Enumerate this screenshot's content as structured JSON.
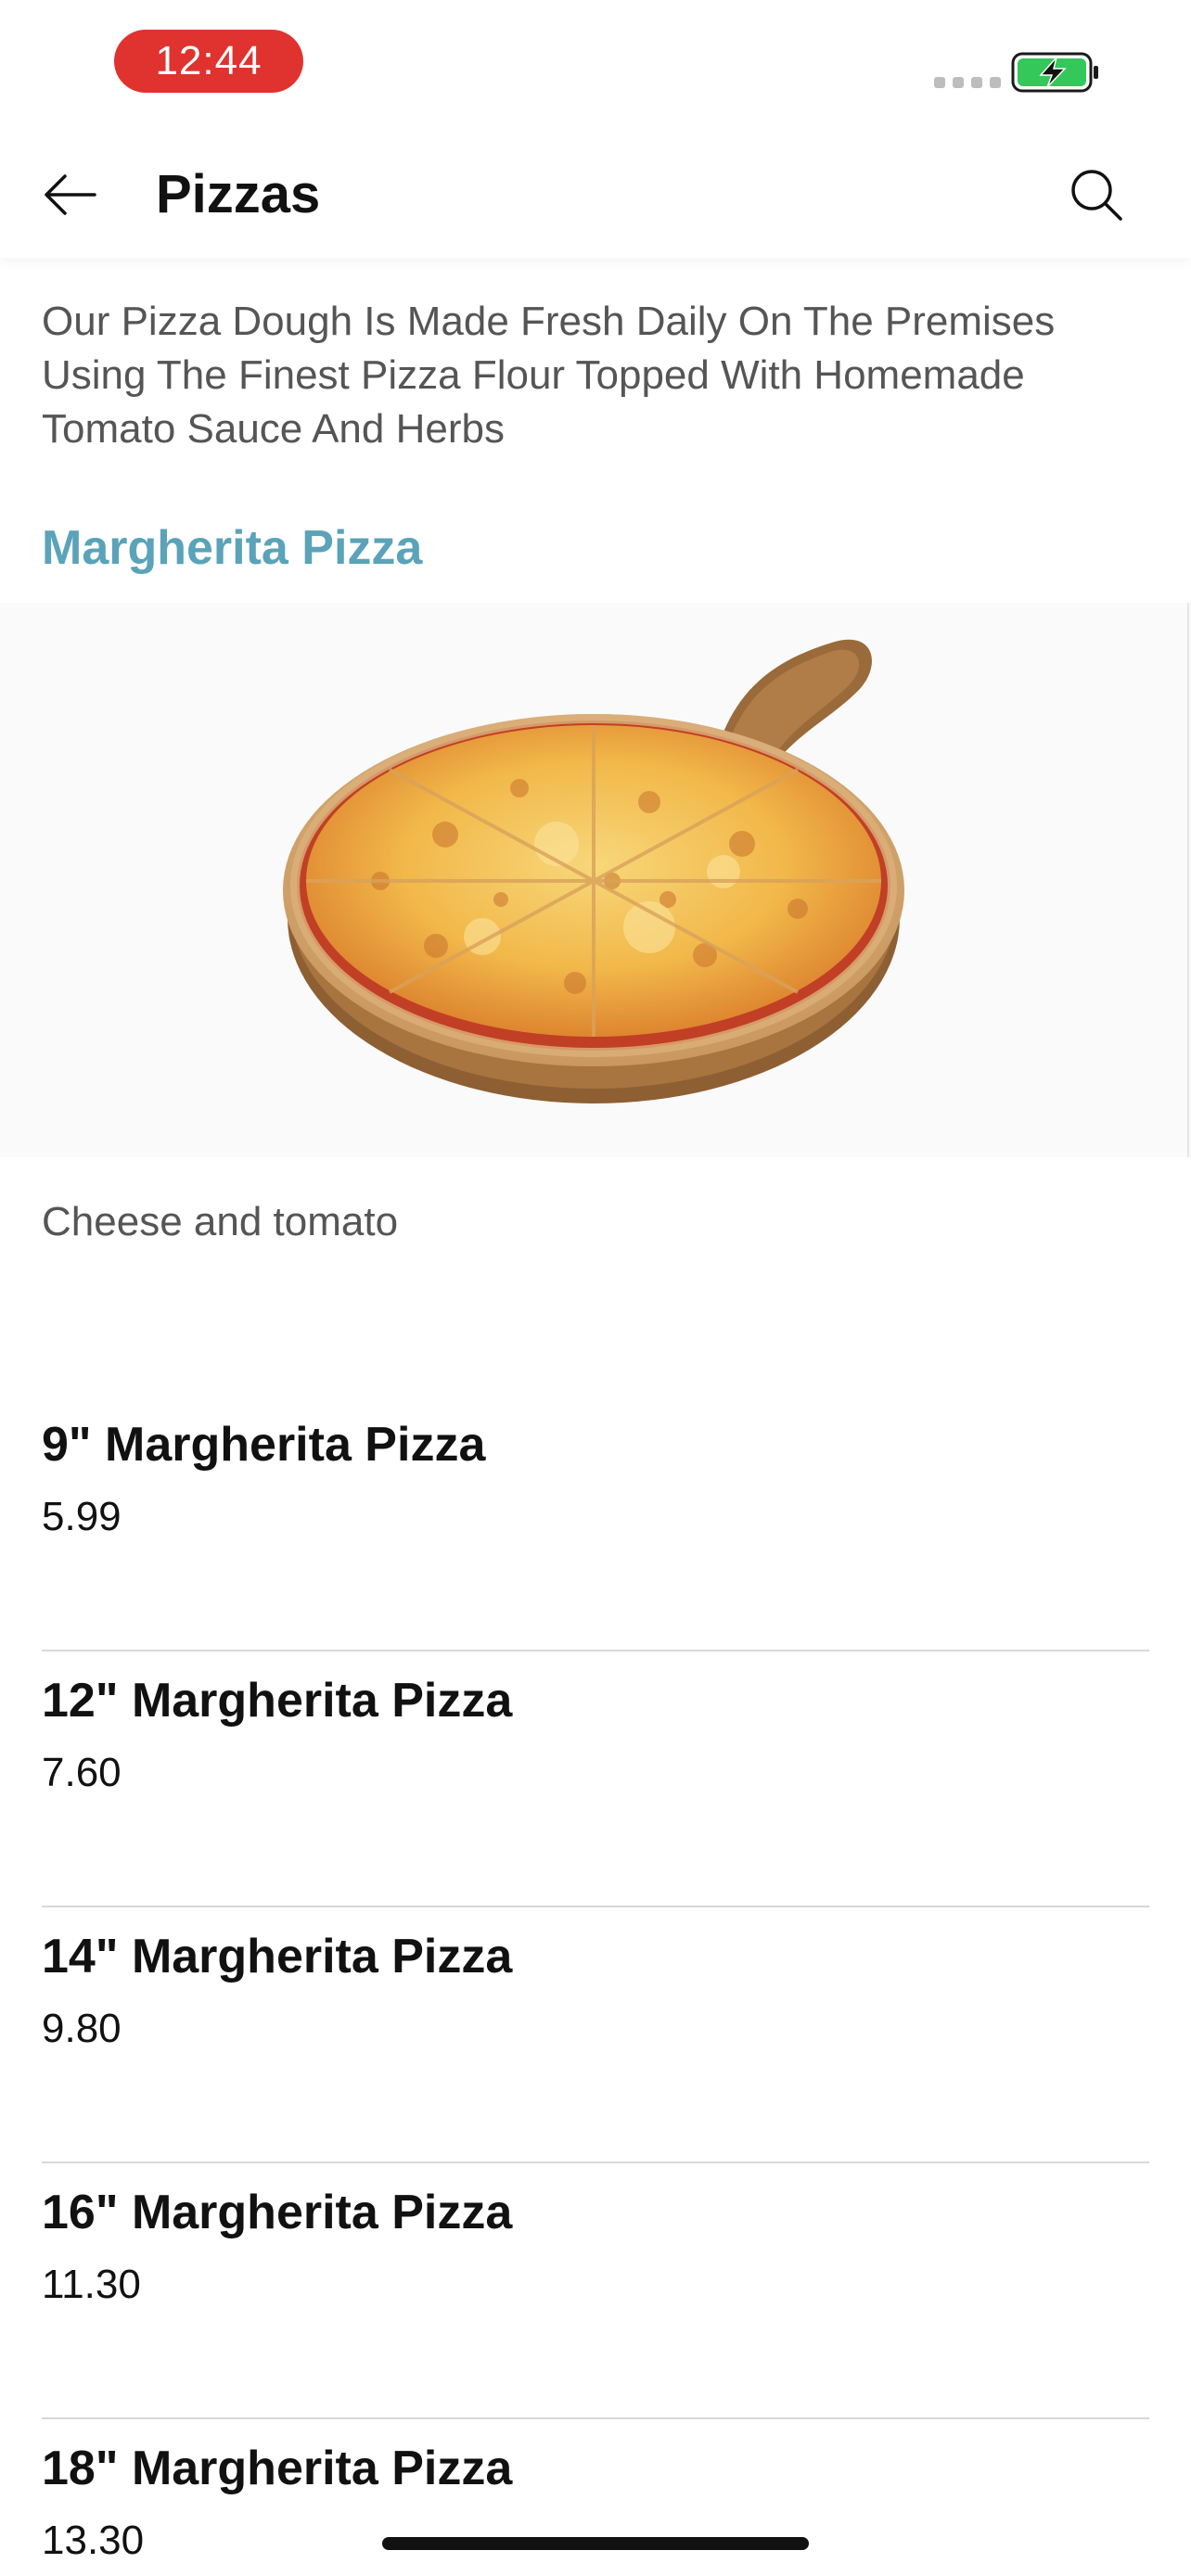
{
  "status_bar": {
    "time": "12:44",
    "battery_icon": "battery-charging-icon",
    "battery_color": "#34c759",
    "time_pill_color": "#e0322f"
  },
  "header": {
    "title": "Pizzas",
    "back_icon": "arrow-left-icon",
    "search_icon": "search-icon"
  },
  "intro": {
    "text": "Our Pizza Dough Is Made Fresh Daily On The Premises Using The Finest Pizza Flour Topped With Homemade Tomato Sauce And Herbs"
  },
  "product": {
    "name": "Margherita Pizza",
    "name_color": "#5aa3b8",
    "description": "Cheese and tomato",
    "image": "margherita-pizza-on-wooden-board"
  },
  "sizes": [
    {
      "name": "9\" Margherita Pizza",
      "price": "5.99"
    },
    {
      "name": "12\" Margherita Pizza",
      "price": "7.60"
    },
    {
      "name": "14\" Margherita Pizza",
      "price": "9.80"
    },
    {
      "name": "16\" Margherita Pizza",
      "price": "11.30"
    },
    {
      "name": "18\" Margherita Pizza",
      "price": "13.30"
    }
  ]
}
